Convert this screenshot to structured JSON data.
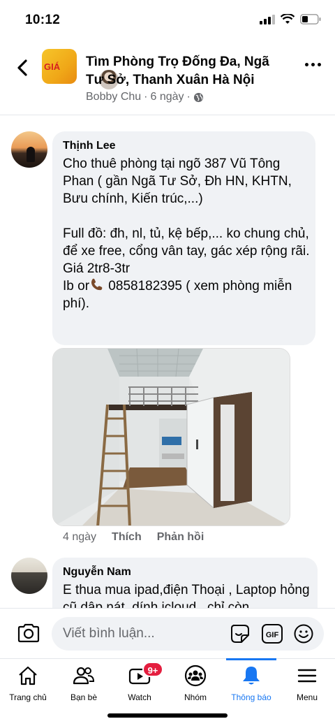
{
  "status": {
    "time": "10:12"
  },
  "header": {
    "title": "Tìm Phòng Trọ Đống Đa, Ngã Tư Sở, Thanh Xuân Hà Nội",
    "author": "Bobby Chu",
    "time": "6 ngày",
    "group_logo_text": "GIÁ"
  },
  "comments": [
    {
      "name": "Thịnh Lee",
      "text": "Cho thuê phòng tại ngõ 387 Vũ Tông Phan ( gần Ngã Tư Sở, Đh HN, KHTN, Bưu chính, Kiến trúc,...)\n\nFull đồ: đh, nl, tủ, kệ bếp,... ko chung chủ, để xe free, cổng vân tay, gác xép rộng rãi.\nGiá 2tr8-3tr",
      "contact_prefix": "Ib or",
      "contact_rest": " 0858182395 ( xem phòng miễn phí).",
      "time": "4 ngày",
      "like": "Thích",
      "reply": "Phản hồi"
    },
    {
      "name": "Nguyễn Nam",
      "text": "E thua mua ipad,điện Thoại , Laptop hỏng cũ dập nát, dính icloud , chỉ còn"
    }
  ],
  "composer": {
    "placeholder": "Viết bình luận...",
    "gif_label": "GIF"
  },
  "tabs": [
    {
      "label": "Trang chủ",
      "icon": "home-icon"
    },
    {
      "label": "Bạn bè",
      "icon": "friends-icon"
    },
    {
      "label": "Watch",
      "icon": "watch-icon",
      "badge": "9+"
    },
    {
      "label": "Nhóm",
      "icon": "groups-icon"
    },
    {
      "label": "Thông báo",
      "icon": "bell-icon",
      "active": true
    },
    {
      "label": "Menu",
      "icon": "menu-icon"
    }
  ],
  "colors": {
    "accent": "#1877f2",
    "badge": "#e41e3f",
    "bubble": "#f0f2f5",
    "muted": "#65676b"
  }
}
